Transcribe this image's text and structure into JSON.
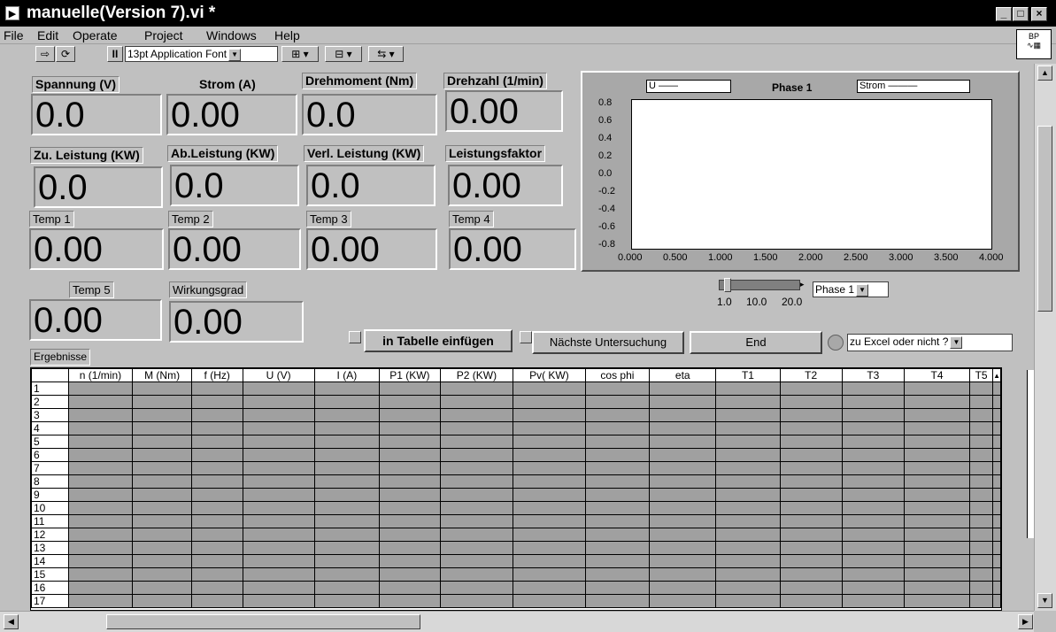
{
  "window": {
    "title": "manuelle(Version 7).vi *",
    "min": "_",
    "max": "□",
    "close": "×"
  },
  "menu": [
    "File",
    "Edit",
    "Operate",
    "Project",
    "Windows",
    "Help"
  ],
  "toolbar": {
    "font": "13pt Application Font",
    "pause": "II"
  },
  "bp_icon": "BP",
  "indicators": {
    "spannung": {
      "label": "Spannung (V)",
      "value": "0.0"
    },
    "strom": {
      "label": "Strom (A)",
      "value": "0.00"
    },
    "drehmoment": {
      "label": "Drehmoment (Nm)",
      "value": "0.0"
    },
    "drehzahl": {
      "label": "Drehzahl (1/min)",
      "value": "0.00"
    },
    "zu_leistung": {
      "label": "Zu. Leistung (KW)",
      "value": "0.0"
    },
    "ab_leistung": {
      "label": "Ab.Leistung (KW)",
      "value": "0.0"
    },
    "verl_leistung": {
      "label": "Verl. Leistung (KW)",
      "value": "0.0"
    },
    "leistungsfaktor": {
      "label": "Leistungsfaktor",
      "value": "0.00"
    },
    "temp1": {
      "label": "Temp 1",
      "value": "0.00"
    },
    "temp2": {
      "label": "Temp 2",
      "value": "0.00"
    },
    "temp3": {
      "label": "Temp 3",
      "value": "0.00"
    },
    "temp4": {
      "label": "Temp 4",
      "value": "0.00"
    },
    "temp5": {
      "label": "Temp 5",
      "value": "0.00"
    },
    "wirkungsgrad": {
      "label": "Wirkungsgrad",
      "value": "0.00"
    }
  },
  "chart": {
    "title": "Phase 1",
    "legend_u": "U",
    "legend_strom": "Strom",
    "y_ticks": [
      "0.8",
      "0.6",
      "0.4",
      "0.2",
      "0.0",
      "-0.2",
      "-0.4",
      "-0.6",
      "-0.8"
    ],
    "x_ticks": [
      "0.000",
      "0.500",
      "1.000",
      "1.500",
      "2.000",
      "2.500",
      "3.000",
      "3.500",
      "4.000"
    ]
  },
  "slider": {
    "ticks": [
      "1.0",
      "10.0",
      "20.0"
    ],
    "phase_select": "Phase 1"
  },
  "buttons": {
    "insert": "in Tabelle einfügen",
    "next": "Nächste Untersuchung",
    "end": "End",
    "excel": "zu Excel oder nicht ?"
  },
  "table": {
    "label": "Ergebnisse",
    "columns": [
      "n (1/min)",
      "M (Nm)",
      "f (Hz)",
      "U (V)",
      "I (A)",
      "P1 (KW)",
      "P2 (KW)",
      "Pv( KW)",
      "cos phi",
      "eta",
      "T1",
      "T2",
      "T3",
      "T4",
      "T5"
    ],
    "rows": [
      "1",
      "2",
      "3",
      "4",
      "5",
      "6",
      "7",
      "8",
      "9",
      "10",
      "11",
      "12",
      "13",
      "14",
      "15",
      "16",
      "17"
    ]
  }
}
